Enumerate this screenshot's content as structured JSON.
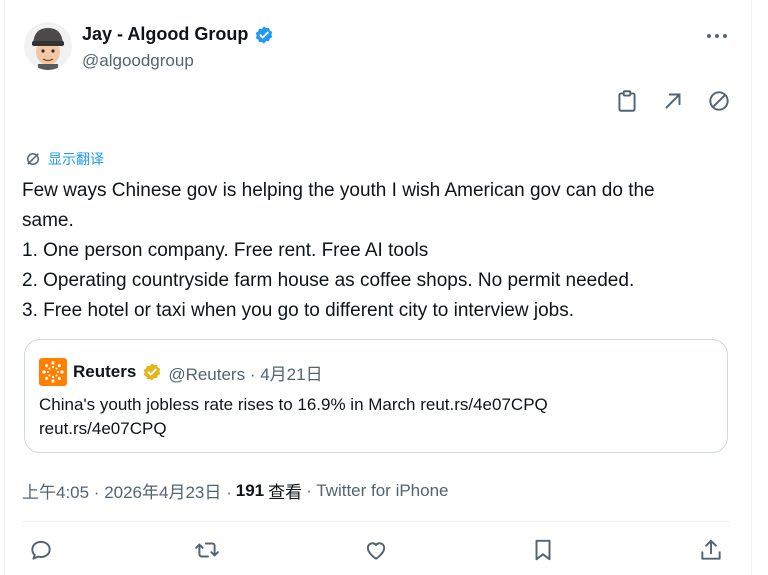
{
  "author": {
    "display_name": "Jay - Algood Group",
    "handle": "@algoodgroup",
    "avatar_icon": "memoji-avatar",
    "verified_color": "#1d9bf0"
  },
  "top_actions": [
    "clipboard-icon",
    "share-arrow-icon",
    "block-icon"
  ],
  "translate_label": "显示翻译",
  "tweet": {
    "lines": [
      "Few ways Chinese gov is helping the youth I wish American gov can do the",
      "same.",
      "1. One person company. Free rent. Free AI tools",
      "2. Operating countryside farm house as coffee shops. No permit needed.",
      "3. Free hotel or taxi when you go to different city to interview jobs."
    ]
  },
  "quote": {
    "name": "Reuters",
    "meta": "@Reuters · 4月21日",
    "line1": "China's youth jobless rate rises to 16.9% in March reut.rs/4e07CPQ",
    "line2": "reut.rs/4e07CPQ",
    "logo_color": "#ff8000",
    "badge_color": "#e2b719"
  },
  "meta": {
    "time": "上午4:05 · 2026年4月23日 ·",
    "views_count": "191",
    "views_label": "查看",
    "source": "· Twitter for iPhone"
  },
  "bottom_actions": [
    "reply-icon",
    "retweet-icon",
    "like-icon",
    "bookmark-icon",
    "share-icon"
  ],
  "colors": {
    "accent": "#1d9bf0",
    "text": "#0f1419",
    "secondary": "#536471",
    "border": "#cfd9de"
  }
}
